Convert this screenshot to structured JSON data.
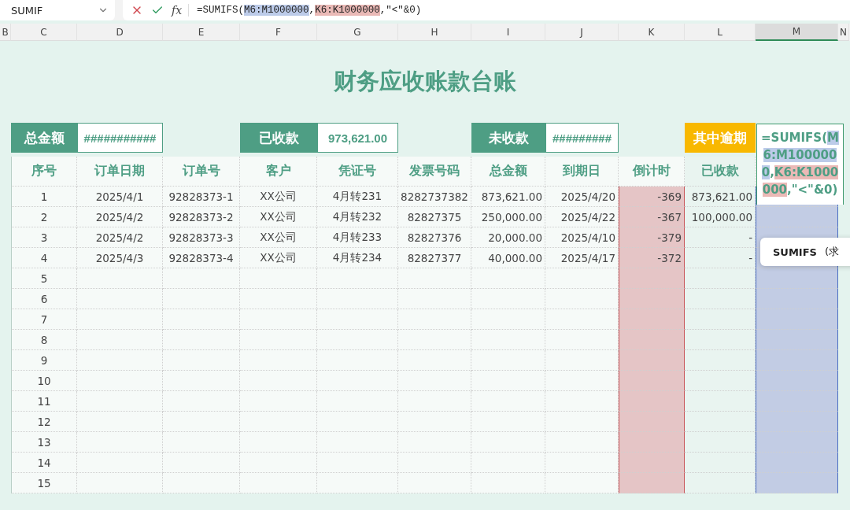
{
  "formula_bar": {
    "name_box": "SUMIF",
    "fx_label": "fx",
    "formula": [
      {
        "kind": "plain",
        "text": "=SUMIFS("
      },
      {
        "kind": "blue",
        "text": "M6:M1000000"
      },
      {
        "kind": "plain",
        "text": ","
      },
      {
        "kind": "red",
        "text": "K6:K1000000"
      },
      {
        "kind": "plain",
        "text": ",″<″&0)"
      }
    ]
  },
  "column_letters": [
    {
      "letter": "B",
      "selected": false
    },
    {
      "letter": "C",
      "selected": false
    },
    {
      "letter": "D",
      "selected": false
    },
    {
      "letter": "E",
      "selected": false
    },
    {
      "letter": "F",
      "selected": false
    },
    {
      "letter": "G",
      "selected": false
    },
    {
      "letter": "H",
      "selected": false
    },
    {
      "letter": "I",
      "selected": false
    },
    {
      "letter": "J",
      "selected": false
    },
    {
      "letter": "K",
      "selected": false,
      "color": "#c9555a"
    },
    {
      "letter": "L",
      "selected": false
    },
    {
      "letter": "M",
      "selected": true,
      "color": "#4a6fc4"
    },
    {
      "letter": "N",
      "selected": false
    }
  ],
  "title": "财务应收账款台账",
  "summary": [
    {
      "label": "总金额",
      "value": "###########",
      "kind": "green"
    },
    {
      "label": "已收款",
      "value": "973,621.00",
      "kind": "green"
    },
    {
      "label": "未收款",
      "value": "#########",
      "kind": "green"
    },
    {
      "label": "其中逾期",
      "kind": "amber"
    }
  ],
  "editing_cell": [
    {
      "kind": "plain",
      "text": "=SUMIFS("
    },
    {
      "kind": "blue",
      "text": "M6:M1000000"
    },
    {
      "kind": "plain",
      "text": ","
    },
    {
      "kind": "red",
      "text": "K6:K1000000"
    },
    {
      "kind": "plain",
      "text": ",\"<\"&0)"
    }
  ],
  "tooltip": {
    "function": "SUMIFS",
    "hint": "(求"
  },
  "table": {
    "columns": [
      "序号",
      "订单日期",
      "订单号",
      "客户",
      "凭证号",
      "发票号码",
      "总金额",
      "到期日",
      "倒计时",
      "已收款"
    ],
    "rows": [
      {
        "cells": [
          "1",
          "2025/4/1",
          "92828373-1",
          "XX公司",
          "4月转231",
          "8282737382",
          "873,621.00",
          "2025/4/20",
          "-369",
          "873,621.00"
        ]
      },
      {
        "cells": [
          "2",
          "2025/4/2",
          "92828373-2",
          "XX公司",
          "4月转232",
          "82827375",
          "250,000.00",
          "2025/4/22",
          "-367",
          "100,000.00"
        ]
      },
      {
        "cells": [
          "3",
          "2025/4/2",
          "92828373-3",
          "XX公司",
          "4月转233",
          "82827376",
          "20,000.00",
          "2025/4/10",
          "-379",
          "-"
        ]
      },
      {
        "cells": [
          "4",
          "2025/4/3",
          "92828373-4",
          "XX公司",
          "4月转234",
          "82827377",
          "40,000.00",
          "2025/4/17",
          "-372",
          "-"
        ]
      },
      {
        "cells": [
          "5"
        ]
      },
      {
        "cells": [
          "6"
        ]
      },
      {
        "cells": [
          "7"
        ]
      },
      {
        "cells": [
          "8"
        ]
      },
      {
        "cells": [
          "9"
        ]
      },
      {
        "cells": [
          "10"
        ]
      },
      {
        "cells": [
          "11"
        ]
      },
      {
        "cells": [
          "12"
        ]
      },
      {
        "cells": [
          "13"
        ]
      },
      {
        "cells": [
          "14"
        ]
      },
      {
        "cells": [
          "15"
        ]
      }
    ]
  }
}
